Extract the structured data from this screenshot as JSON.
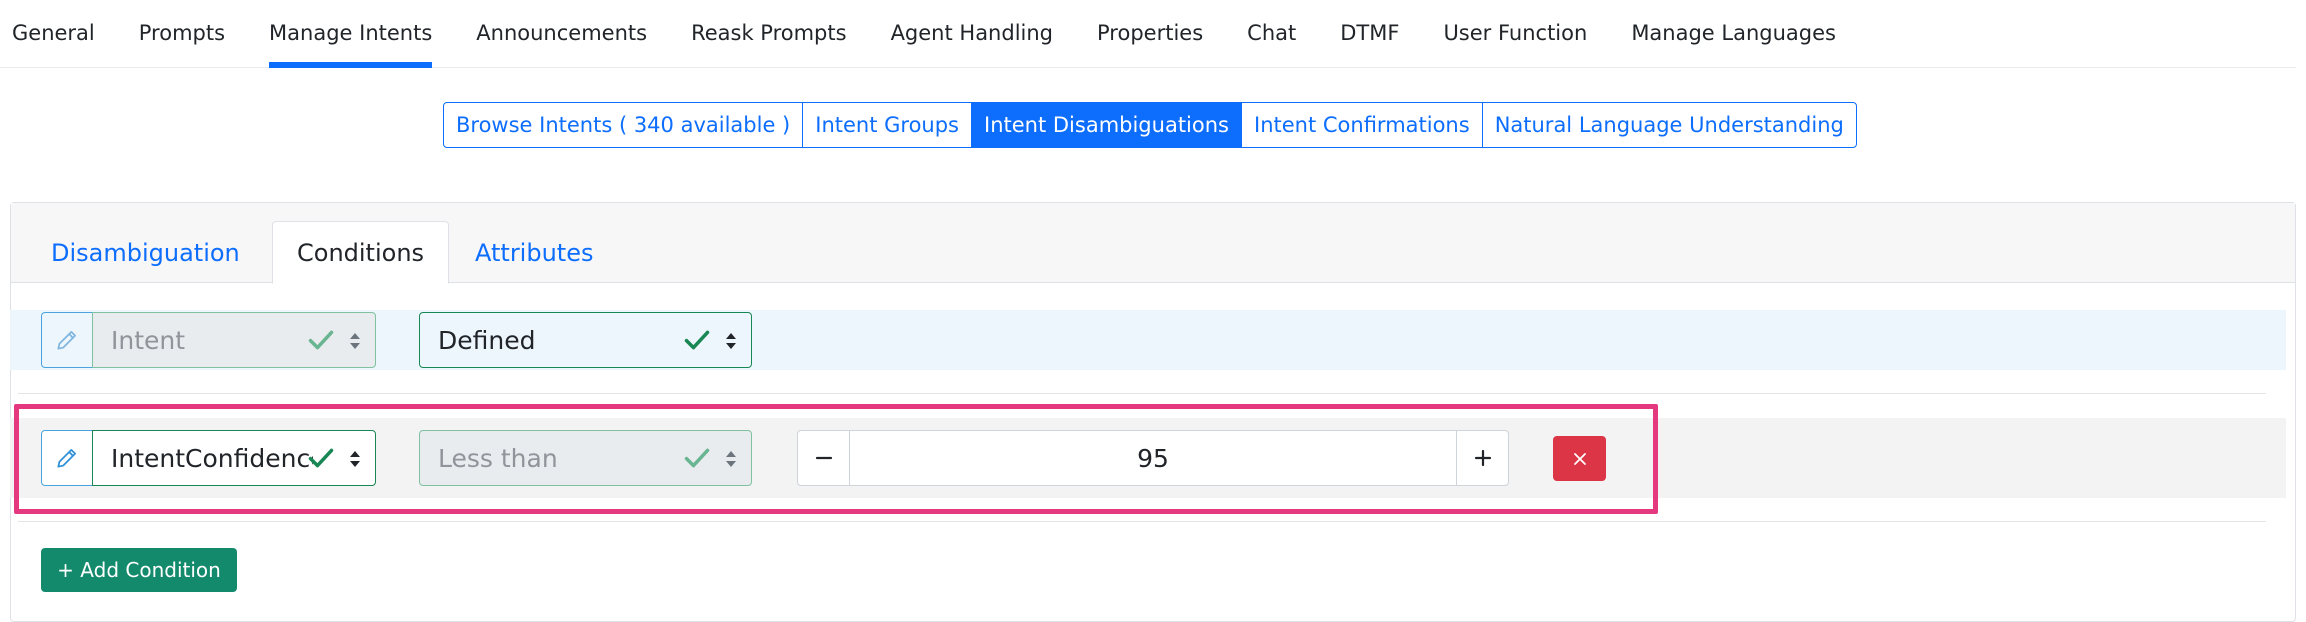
{
  "topnav": {
    "tabs": [
      {
        "label": "General"
      },
      {
        "label": "Prompts"
      },
      {
        "label": "Manage Intents"
      },
      {
        "label": "Announcements"
      },
      {
        "label": "Reask Prompts"
      },
      {
        "label": "Agent Handling"
      },
      {
        "label": "Properties"
      },
      {
        "label": "Chat"
      },
      {
        "label": "DTMF"
      },
      {
        "label": "User Function"
      },
      {
        "label": "Manage Languages"
      }
    ],
    "active": "Manage Intents"
  },
  "intent_nav": {
    "items": [
      {
        "label": "Browse Intents ( 340 available )"
      },
      {
        "label": "Intent Groups"
      },
      {
        "label": "Intent Disambiguations"
      },
      {
        "label": "Intent Confirmations"
      },
      {
        "label": "Natural Language Understanding"
      }
    ],
    "active": "Intent Disambiguations"
  },
  "card_tabs": {
    "items": [
      {
        "label": "Disambiguation"
      },
      {
        "label": "Conditions"
      },
      {
        "label": "Attributes"
      }
    ],
    "active": "Conditions"
  },
  "conditions": [
    {
      "field": "Intent",
      "operator": "Defined",
      "field_disabled": true
    },
    {
      "field": "IntentConfidence",
      "operator": "Less than",
      "value": "95",
      "operator_disabled": true
    }
  ],
  "add_condition_label": "+ Add Condition",
  "colors": {
    "primary": "#0d6efd",
    "success": "#198754",
    "danger": "#dc3545",
    "highlight": "#e5397f",
    "add_button": "#148a6c"
  },
  "icons": {
    "edit": "pencil-icon",
    "valid": "check-icon",
    "select": "sort-arrows-icon",
    "decrement": "minus-icon",
    "increment": "plus-icon",
    "delete": "close-icon"
  }
}
